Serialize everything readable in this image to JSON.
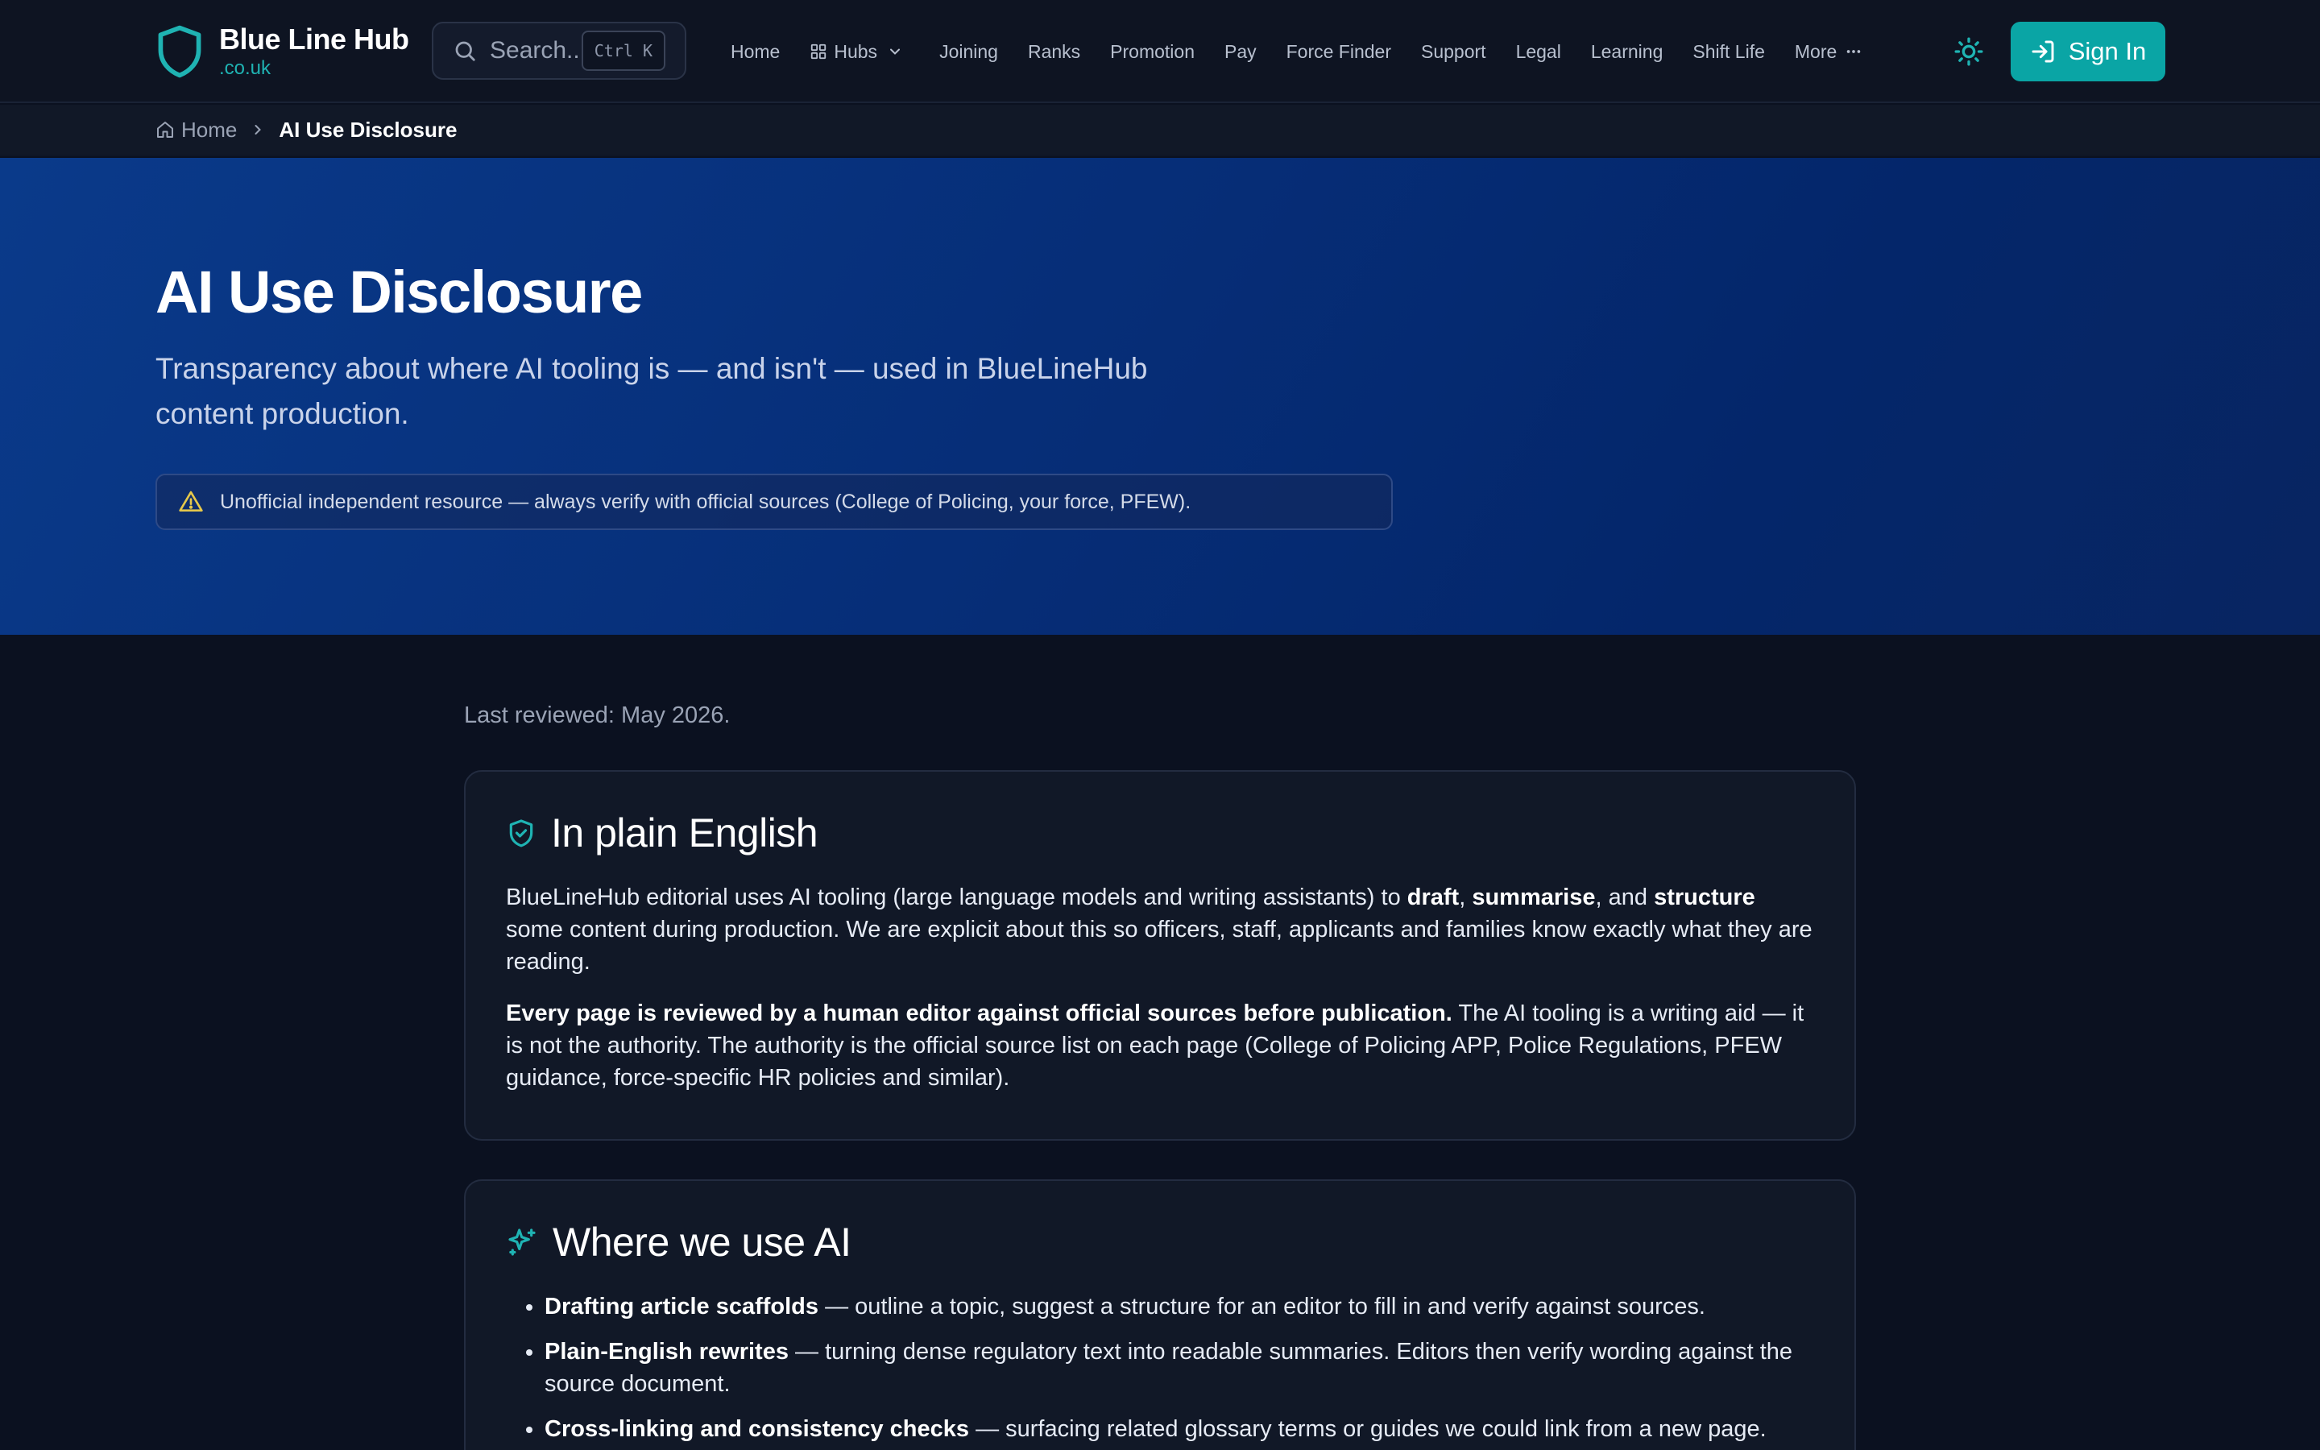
{
  "brand": {
    "name": "Blue Line Hub",
    "domain": ".co.uk"
  },
  "search": {
    "placeholder": "Search...",
    "shortcut": "Ctrl K"
  },
  "nav": {
    "home": "Home",
    "hubs": "Hubs",
    "joining": "Joining",
    "ranks": "Ranks",
    "promotion": "Promotion",
    "pay": "Pay",
    "force_finder": "Force Finder",
    "support": "Support",
    "legal": "Legal",
    "learning": "Learning",
    "shift_life": "Shift Life",
    "more": "More"
  },
  "auth": {
    "sign_in": "Sign In"
  },
  "breadcrumb": {
    "home": "Home",
    "current": "AI Use Disclosure"
  },
  "hero": {
    "title": "AI Use Disclosure",
    "subtitle": "Transparency about where AI tooling is — and isn't — used in BlueLineHub content production.",
    "notice": "Unofficial independent resource — always verify with official sources (College of Policing, your force, PFEW)."
  },
  "content": {
    "last_reviewed": "Last reviewed: May 2026.",
    "plain_english": {
      "title": "In plain English",
      "p1_pre": "BlueLineHub editorial uses AI tooling (large language models and writing assistants) to ",
      "p1_b1": "draft",
      "p1_sep1": ", ",
      "p1_b2": "summarise",
      "p1_sep2": ", and ",
      "p1_b3": "structure",
      "p1_post": " some content during production. We are explicit about this so officers, staff, applicants and families know exactly what they are reading.",
      "p2_bold": "Every page is reviewed by a human editor against official sources before publication.",
      "p2_rest": " The AI tooling is a writing aid — it is not the authority. The authority is the official source list on each page (College of Policing APP, Police Regulations, PFEW guidance, force-specific HR policies and similar)."
    },
    "where_we_use": {
      "title": "Where we use AI",
      "items": [
        {
          "bold": "Drafting article scaffolds",
          "text": " — outline a topic, suggest a structure for an editor to fill in and verify against sources."
        },
        {
          "bold": "Plain-English rewrites",
          "text": " — turning dense regulatory text into readable summaries. Editors then verify wording against the source document."
        },
        {
          "bold": "Cross-linking and consistency checks",
          "text": " — surfacing related glossary terms or guides we could link from a new page."
        }
      ]
    }
  },
  "colors": {
    "background": "#0b1120",
    "header": "#0e1422",
    "accent": "#0aa5a5",
    "hero_start": "#0a3a8a",
    "hero_end": "#04266a",
    "card": "#111827",
    "warning": "#e6c84a"
  },
  "icons": {
    "brand": "shield-icon",
    "search": "search-icon",
    "hubs": "grid-icon",
    "hubs_caret": "chevron-down-icon",
    "more": "ellipsis-icon",
    "theme": "sun-icon",
    "sign_in": "log-in-icon",
    "breadcrumb_home": "house-icon",
    "breadcrumb_sep": "chevron-right-icon",
    "notice": "warning-triangle-icon",
    "plain_english": "shield-check-icon",
    "where_we_use": "sparkles-icon"
  }
}
